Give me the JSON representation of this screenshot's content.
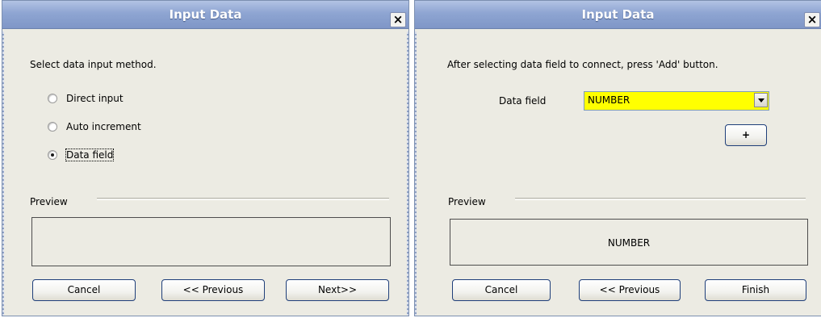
{
  "dialog1": {
    "title": "Input Data",
    "close_glyph": "×",
    "prompt": "Select data input method.",
    "options": [
      {
        "label": "Direct input",
        "checked": false
      },
      {
        "label": "Auto increment",
        "checked": false
      },
      {
        "label": "Data field",
        "checked": true
      }
    ],
    "preview_label": "Preview",
    "preview_value": "",
    "buttons": {
      "cancel": "Cancel",
      "previous": "<< Previous",
      "next": "Next>>"
    }
  },
  "dialog2": {
    "title": "Input Data",
    "close_glyph": "×",
    "prompt": "After selecting data field to connect, press 'Add' button.",
    "data_field_label": "Data field",
    "data_field_value": "NUMBER",
    "add_button": "+",
    "preview_label": "Preview",
    "preview_value": "NUMBER",
    "buttons": {
      "cancel": "Cancel",
      "previous": "<< Previous",
      "finish": "Finish"
    }
  },
  "colors": {
    "dialog_bg": "#ecebe3",
    "titlebar": "#8ea5d2",
    "field_highlight": "#ffff00",
    "button_border": "#1f3f7a"
  },
  "icons": {
    "close": "close-icon",
    "dropdown": "chevron-down-icon",
    "radio": "radio-button"
  }
}
